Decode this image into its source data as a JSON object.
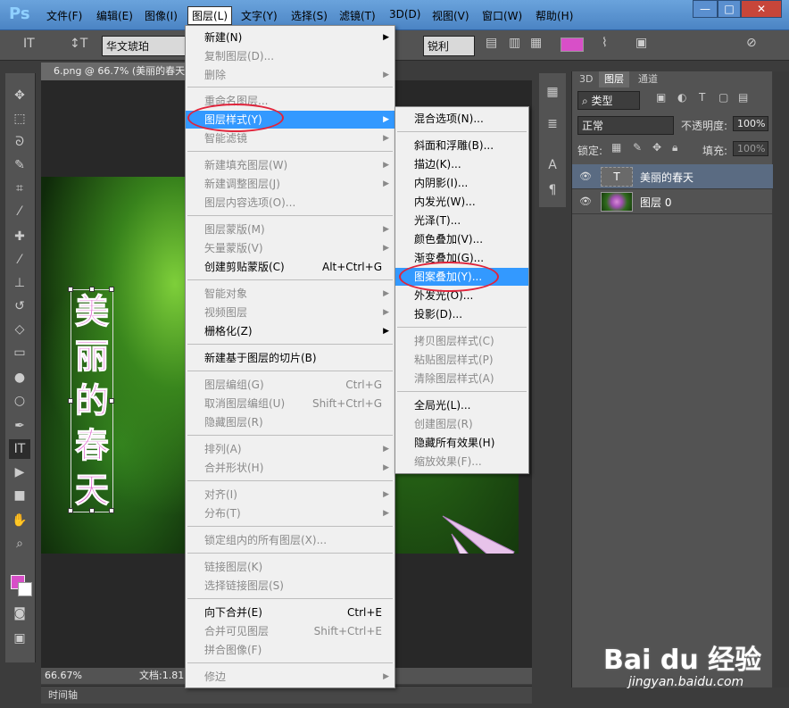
{
  "app": {
    "logo": "Ps"
  },
  "menubar": {
    "items": [
      "文件(F)",
      "编辑(E)",
      "图像(I)",
      "图层(L)",
      "文字(Y)",
      "选择(S)",
      "滤镜(T)",
      "3D(D)",
      "视图(V)",
      "窗口(W)",
      "帮助(H)"
    ],
    "window_controls": [
      "—",
      "□",
      "✕"
    ]
  },
  "options": {
    "font_family": "华文琥珀",
    "antialias": "锐利",
    "color": "#d84fc8"
  },
  "document": {
    "tab_title": "6.png @ 66.7% (美丽的春天",
    "vertical_text": [
      "美",
      "丽",
      "的",
      "春",
      "天"
    ],
    "zoom": "66.67%",
    "doc_info": "文档:1.81"
  },
  "timeline": {
    "label": "时间轴"
  },
  "layers_panel": {
    "tabs": [
      "3D",
      "图层",
      "通道"
    ],
    "filter": "类型",
    "blend_mode": "正常",
    "opacity_label": "不透明度:",
    "opacity_value": "100%",
    "lock_label": "锁定:",
    "fill_label": "填充:",
    "fill_value": "100%",
    "layers": [
      {
        "name": "美丽的春天",
        "type": "text",
        "selected": true
      },
      {
        "name": "图层 0",
        "type": "image",
        "selected": false
      }
    ]
  },
  "layer_menu": {
    "items": [
      {
        "label": "新建(N)",
        "submenu": true
      },
      {
        "label": "复制图层(D)...",
        "disabled": true
      },
      {
        "label": "删除",
        "submenu": true,
        "disabled": true
      },
      {
        "label": "重命名图层...",
        "disabled": true
      },
      {
        "label": "图层样式(Y)",
        "submenu": true,
        "highlighted": true
      },
      {
        "label": "智能滤镜",
        "submenu": true,
        "disabled": true
      },
      {
        "label": "新建填充图层(W)",
        "submenu": true,
        "disabled": true
      },
      {
        "label": "新建调整图层(J)",
        "submenu": true,
        "disabled": true
      },
      {
        "label": "图层内容选项(O)...",
        "disabled": true
      },
      {
        "label": "图层蒙版(M)",
        "submenu": true,
        "disabled": true
      },
      {
        "label": "矢量蒙版(V)",
        "submenu": true,
        "disabled": true
      },
      {
        "label": "创建剪贴蒙版(C)",
        "shortcut": "Alt+Ctrl+G"
      },
      {
        "label": "智能对象",
        "submenu": true,
        "disabled": true
      },
      {
        "label": "视频图层",
        "submenu": true,
        "disabled": true
      },
      {
        "label": "栅格化(Z)",
        "submenu": true
      },
      {
        "label": "新建基于图层的切片(B)"
      },
      {
        "label": "图层编组(G)",
        "shortcut": "Ctrl+G",
        "disabled": true
      },
      {
        "label": "取消图层编组(U)",
        "shortcut": "Shift+Ctrl+G",
        "disabled": true
      },
      {
        "label": "隐藏图层(R)",
        "disabled": true
      },
      {
        "label": "排列(A)",
        "submenu": true,
        "disabled": true
      },
      {
        "label": "合并形状(H)",
        "submenu": true,
        "disabled": true
      },
      {
        "label": "对齐(I)",
        "submenu": true,
        "disabled": true
      },
      {
        "label": "分布(T)",
        "submenu": true,
        "disabled": true
      },
      {
        "label": "锁定组内的所有图层(X)...",
        "disabled": true
      },
      {
        "label": "链接图层(K)",
        "disabled": true
      },
      {
        "label": "选择链接图层(S)",
        "disabled": true
      },
      {
        "label": "向下合并(E)",
        "shortcut": "Ctrl+E"
      },
      {
        "label": "合并可见图层",
        "shortcut": "Shift+Ctrl+E",
        "disabled": true
      },
      {
        "label": "拼合图像(F)",
        "disabled": true
      },
      {
        "label": "修边",
        "submenu": true,
        "disabled": true
      }
    ]
  },
  "style_submenu": {
    "items": [
      {
        "label": "混合选项(N)..."
      },
      {
        "label": "斜面和浮雕(B)..."
      },
      {
        "label": "描边(K)..."
      },
      {
        "label": "内阴影(I)..."
      },
      {
        "label": "内发光(W)..."
      },
      {
        "label": "光泽(T)..."
      },
      {
        "label": "颜色叠加(V)..."
      },
      {
        "label": "渐变叠加(G)..."
      },
      {
        "label": "图案叠加(Y)...",
        "highlighted": true
      },
      {
        "label": "外发光(O)..."
      },
      {
        "label": "投影(D)..."
      },
      {
        "label": "拷贝图层样式(C)",
        "disabled": true
      },
      {
        "label": "粘贴图层样式(P)",
        "disabled": true
      },
      {
        "label": "清除图层样式(A)",
        "disabled": true
      },
      {
        "label": "全局光(L)..."
      },
      {
        "label": "创建图层(R)",
        "disabled": true
      },
      {
        "label": "隐藏所有效果(H)"
      },
      {
        "label": "缩放效果(F)...",
        "disabled": true
      }
    ]
  },
  "watermark": {
    "text": "Bai du 经验",
    "sub": "jingyan.baidu.com"
  }
}
